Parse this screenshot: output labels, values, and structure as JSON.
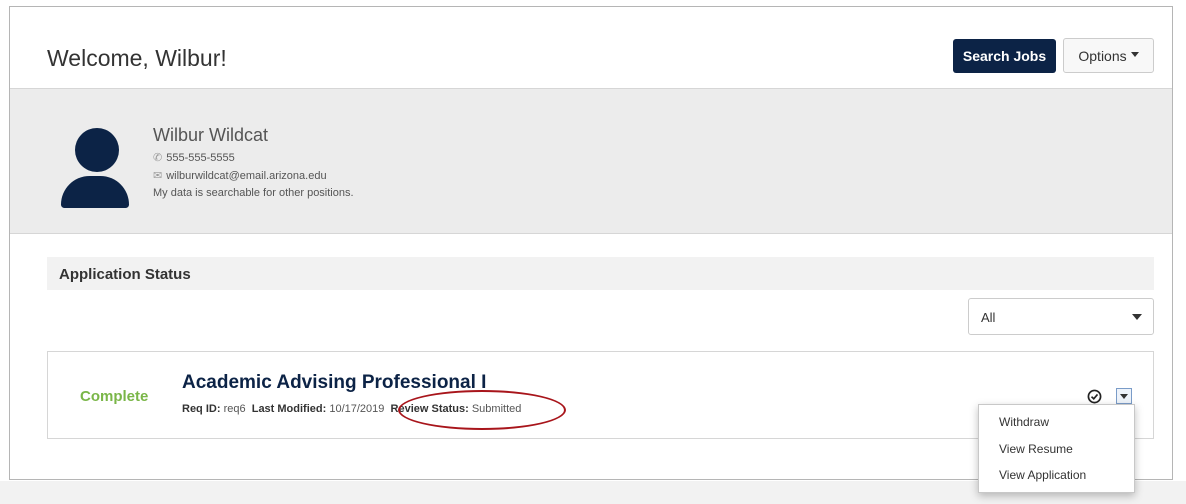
{
  "header": {
    "welcome": "Welcome, Wilbur!",
    "search_jobs_label": "Search Jobs",
    "options_label": "Options"
  },
  "profile": {
    "name": "Wilbur Wildcat",
    "phone": "555-555-5555",
    "email": "wilburwildcat@email.arizona.edu",
    "searchable_note": "My data is searchable for other positions."
  },
  "application_status": {
    "title": "Application Status",
    "filter_value": "All"
  },
  "application": {
    "status": "Complete",
    "title": "Academic Advising Professional I",
    "req_id_label": "Req ID:",
    "req_id": "req6",
    "last_modified_label": "Last Modified:",
    "last_modified": "10/17/2019",
    "review_status_label": "Review Status:",
    "review_status": "Submitted"
  },
  "action_menu": {
    "items": [
      "Withdraw",
      "View Resume",
      "View Application"
    ]
  },
  "colors": {
    "brand_navy": "#0c2346",
    "complete_green": "#7ab648",
    "highlight_red": "#a8151b"
  },
  "icons": {
    "phone": "phone-icon",
    "email": "envelope-icon",
    "check": "check-circle-icon",
    "dropdown": "caret-down-icon"
  }
}
